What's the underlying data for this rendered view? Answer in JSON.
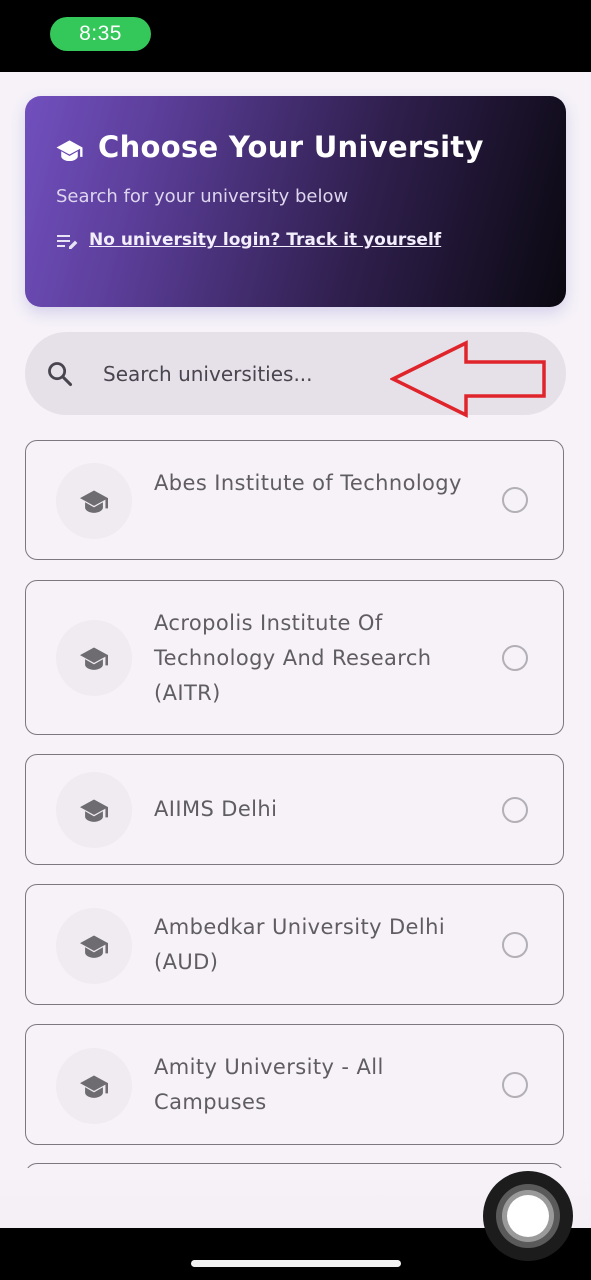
{
  "status_bar": {
    "time": "8:35"
  },
  "header": {
    "title": "Choose Your University",
    "subtitle": "Search for your university below",
    "track_link": "No university login? Track it yourself",
    "gradient_colors": [
      "#7150be",
      "#0a0810"
    ]
  },
  "search": {
    "placeholder": "Search universities...",
    "value": ""
  },
  "annotation": {
    "arrow_color": "#e0242b"
  },
  "universities": [
    {
      "name": "Abes Institute of Technology",
      "selected": false
    },
    {
      "name": "Acropolis Institute Of Technology And Research (AITR)",
      "selected": false
    },
    {
      "name": "AIIMS Delhi",
      "selected": false
    },
    {
      "name": "Ambedkar University Delhi (AUD)",
      "selected": false
    },
    {
      "name": "Amity University - All Campuses",
      "selected": false
    }
  ],
  "icons": {
    "title": "graduation-cap-icon",
    "track": "edit-list-icon",
    "search": "search-icon",
    "item": "graduation-cap-icon",
    "radio": "radio-unchecked-icon"
  }
}
